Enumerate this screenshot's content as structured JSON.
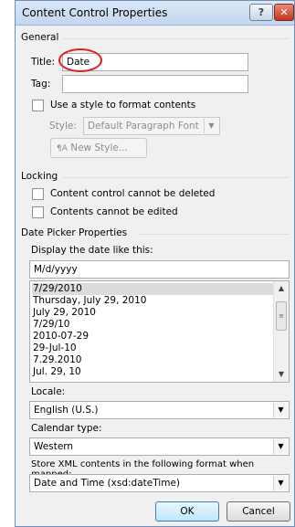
{
  "window": {
    "title": "Content Control Properties",
    "help_glyph": "?",
    "close_glyph": "✕"
  },
  "general": {
    "label": "General",
    "title_label": "Title:",
    "title_value": "Date",
    "tag_label": "Tag:",
    "tag_value": "",
    "use_style_label": "Use a style to format contents",
    "style_label": "Style:",
    "style_value": "Default Paragraph Font",
    "new_style_button": "New Style..."
  },
  "locking": {
    "label": "Locking",
    "cannot_delete": "Content control cannot be deleted",
    "cannot_edit": "Contents cannot be edited"
  },
  "date_picker": {
    "label": "Date Picker Properties",
    "display_label": "Display the date like this:",
    "format_value": "M/d/yyyy",
    "formats": [
      "7/29/2010",
      "Thursday, July 29, 2010",
      "July 29, 2010",
      "7/29/10",
      "2010-07-29",
      "29-Jul-10",
      "7.29.2010",
      "Jul. 29, 10"
    ],
    "locale_label": "Locale:",
    "locale_value": "English (U.S.)",
    "calendar_label": "Calendar type:",
    "calendar_value": "Western",
    "xml_label": "Store XML contents in the following format when mapped:",
    "xml_value": "Date and Time (xsd:dateTime)"
  },
  "buttons": {
    "ok": "OK",
    "cancel": "Cancel"
  },
  "colors": {
    "annotation": "#e02020",
    "selection": "#dcdcdc"
  }
}
